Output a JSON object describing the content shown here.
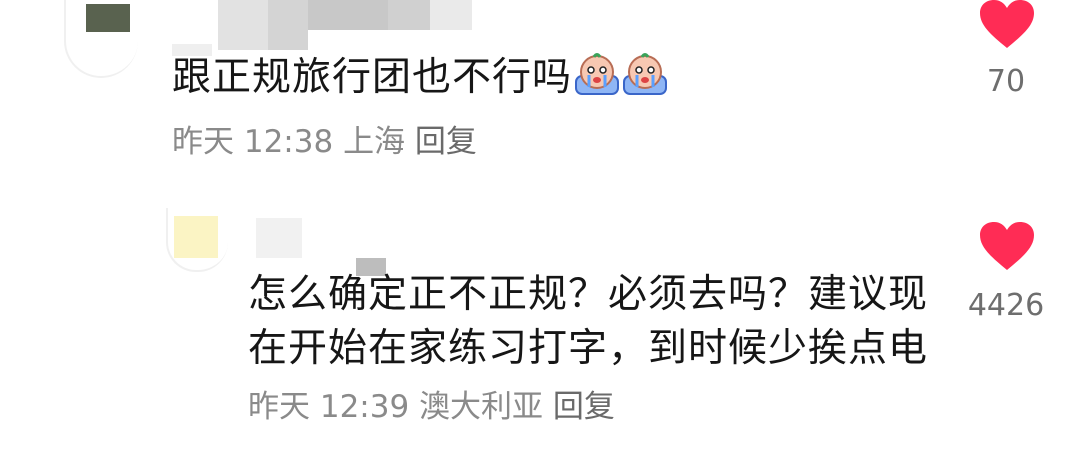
{
  "comment1": {
    "text": "跟正规旅行团也不行吗",
    "emojis": [
      "crying-face-emoji",
      "crying-face-emoji"
    ],
    "time": "昨天 12:38",
    "location": "上海",
    "reply_label": "回复",
    "like_count": "70"
  },
  "comment2": {
    "text": "怎么确定正不正规？必须去吗？建议现在开始在家练习打字，到时候少挨点电",
    "time": "昨天 12:39",
    "location": "澳大利亚",
    "reply_label": "回复",
    "like_count": "4426"
  },
  "colors": {
    "heart": "#ff2c55",
    "meta": "#8a8a8a",
    "text": "#161616"
  }
}
